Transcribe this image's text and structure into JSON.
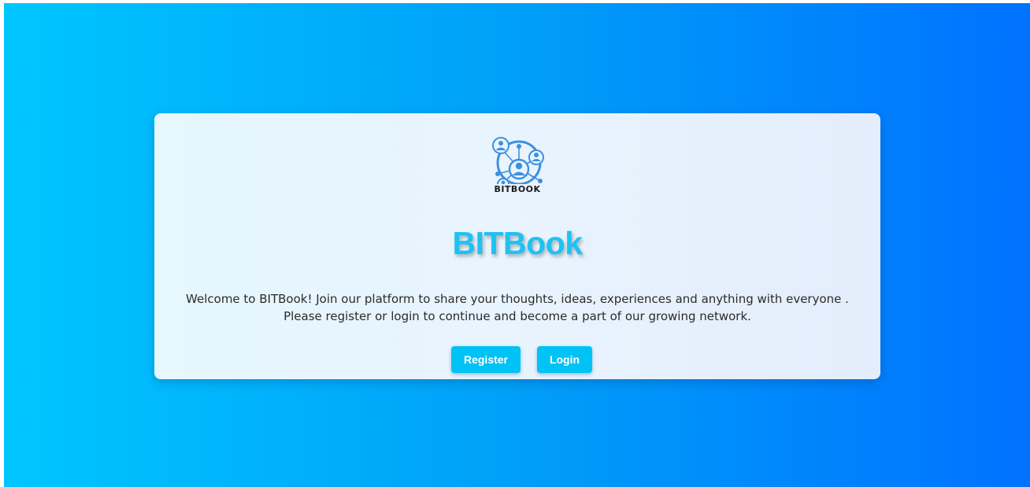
{
  "app": {
    "logo_text": "BITBOOK",
    "title": "BITBook",
    "welcome_line1": "Welcome to BITBook! Join our platform to share your thoughts, ideas, experiences and anything with everyone .",
    "welcome_line2": "Please register or login to continue and become a part of our growing network."
  },
  "actions": {
    "register_label": "Register",
    "login_label": "Login"
  },
  "colors": {
    "background_gradient_start": "#00c6ff",
    "background_gradient_end": "#0072ff",
    "title": "#1ec2f2",
    "button": "#00c2f5",
    "logo": "#3f8fe0"
  },
  "icons": {
    "logo": "network-people-icon"
  }
}
